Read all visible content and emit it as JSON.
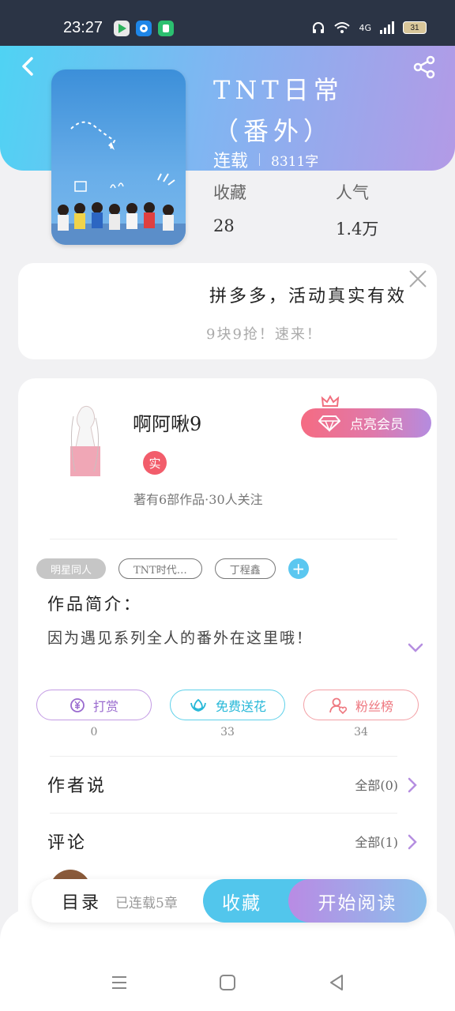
{
  "status_bar": {
    "time": "23:27",
    "network": "4G",
    "battery": "31"
  },
  "book": {
    "title": "TNT日常（番外）",
    "status": "连载",
    "word_count": "8311字",
    "favorites_label": "收藏",
    "favorites_value": "28",
    "popularity_label": "人气",
    "popularity_value": "1.4万"
  },
  "ad": {
    "title": "拼多多，活动真实有效",
    "subtitle": "9块9抢！速来！"
  },
  "author": {
    "name": "啊阿啾9",
    "real_badge": "实",
    "meta": "著有6部作品·30人关注",
    "vip_button": "点亮会员"
  },
  "tags": [
    "明星同人",
    "TNT时代…",
    "丁程鑫"
  ],
  "intro": {
    "label": "作品简介：",
    "text": "因为遇见系列全人的番外在这里哦！"
  },
  "actions": [
    {
      "label": "打赏",
      "count": "0"
    },
    {
      "label": "免费送花",
      "count": "33"
    },
    {
      "label": "粉丝榜",
      "count": "34"
    }
  ],
  "author_says": {
    "label": "作者说",
    "more": "全部(0)"
  },
  "comments": {
    "label": "评论",
    "more": "全部(1)"
  },
  "bottom_bar": {
    "toc": "目录",
    "serial": "已连载5章",
    "favorite": "收藏",
    "start_reading": "开始阅读"
  },
  "colors": {
    "header_start": "#4fd3f3",
    "header_end": "#b39ae6",
    "accent_blue": "#52c6ec",
    "accent_red": "#f25d6b"
  }
}
